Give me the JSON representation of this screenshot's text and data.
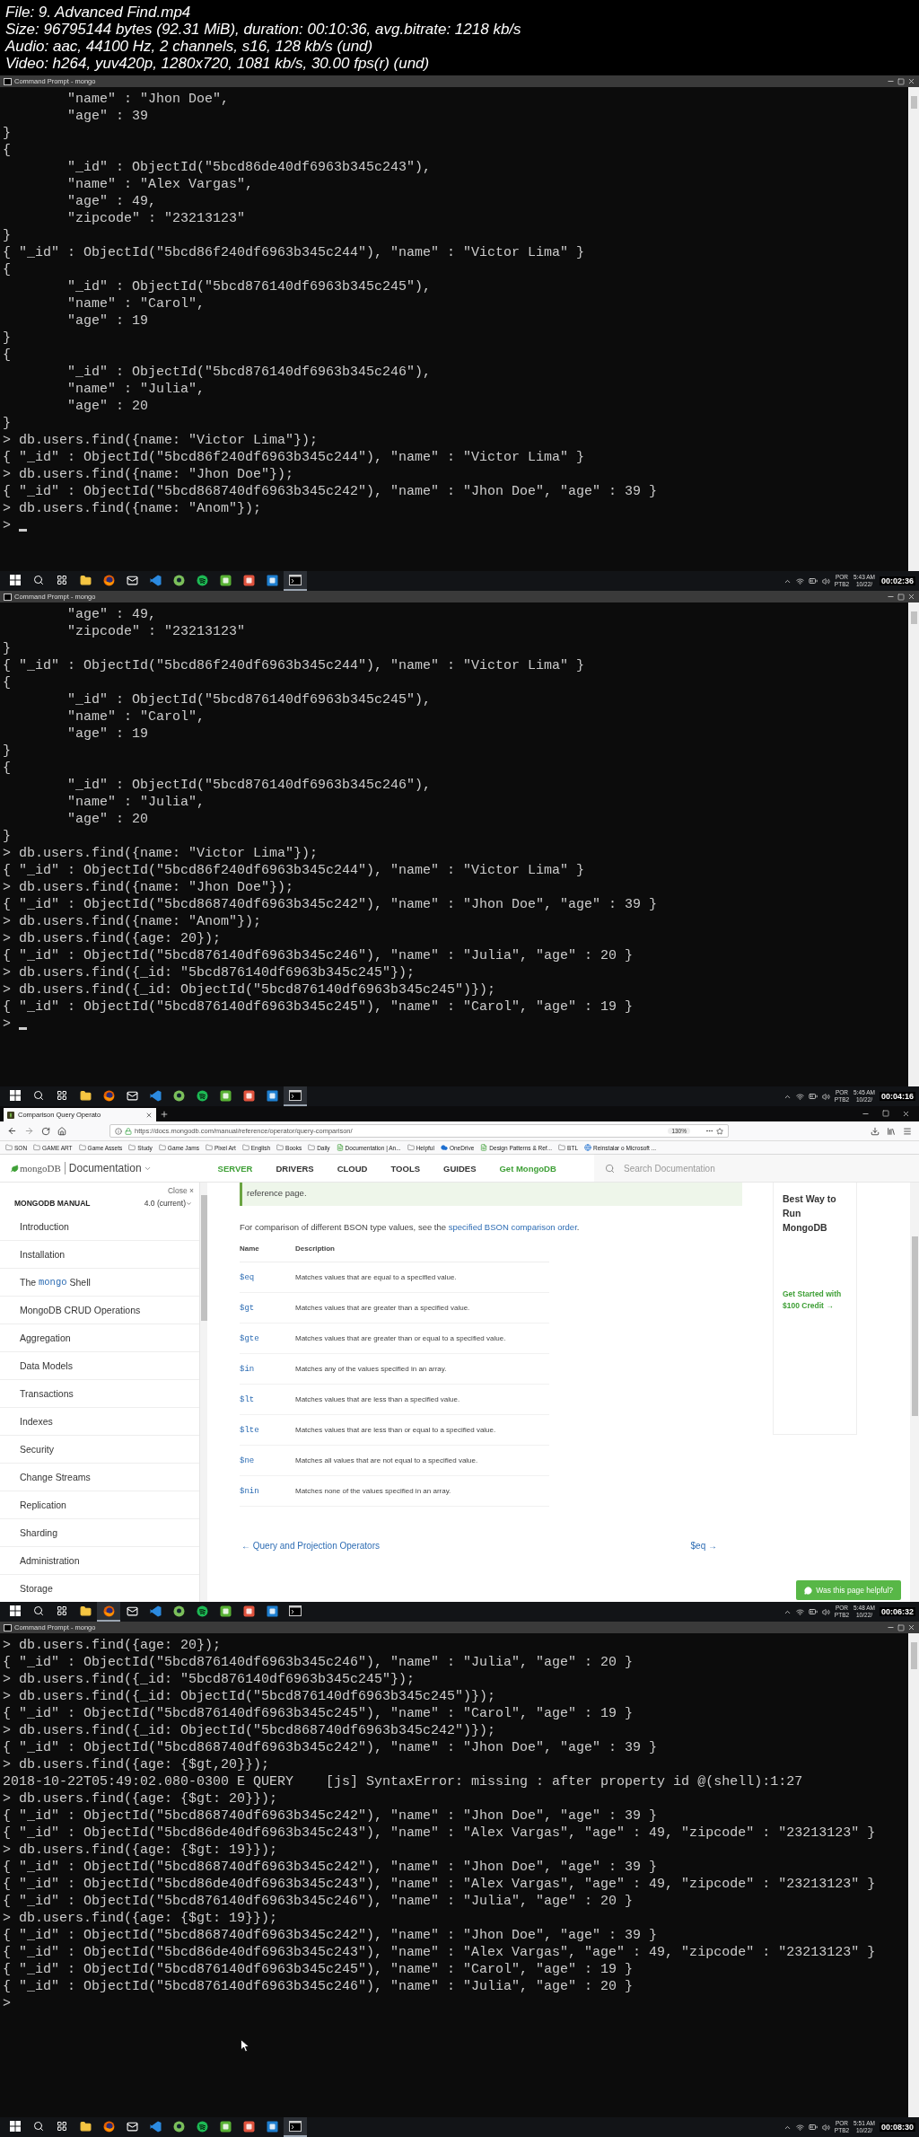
{
  "file_info": [
    "File: 9. Advanced Find.mp4",
    "Size: 96795144 bytes (92.31 MiB), duration: 00:10:36, avg.bitrate: 1218 kb/s",
    "Audio: aac, 44100 Hz, 2 channels, s16, 128 kb/s (und)",
    "Video: h264, yuv420p, 1280x720, 1081 kb/s, 30.00 fps(r) (und)"
  ],
  "frames": [
    {
      "kind": "terminal",
      "window_title": "Command Prompt - mongo",
      "cursor": true,
      "lines": [
        "        \"name\" : \"Jhon Doe\",",
        "        \"age\" : 39",
        "}",
        "{",
        "        \"_id\" : ObjectId(\"5bcd86de40df6963b345c243\"),",
        "        \"name\" : \"Alex Vargas\",",
        "        \"age\" : 49,",
        "        \"zipcode\" : \"23213123\"",
        "}",
        "{ \"_id\" : ObjectId(\"5bcd86f240df6963b345c244\"), \"name\" : \"Victor Lima\" }",
        "{",
        "        \"_id\" : ObjectId(\"5bcd876140df6963b345c245\"),",
        "        \"name\" : \"Carol\",",
        "        \"age\" : 19",
        "}",
        "{",
        "        \"_id\" : ObjectId(\"5bcd876140df6963b345c246\"),",
        "        \"name\" : \"Julia\",",
        "        \"age\" : 20",
        "}",
        "> db.users.find({name: \"Victor Lima\"});",
        "{ \"_id\" : ObjectId(\"5bcd86f240df6963b345c244\"), \"name\" : \"Victor Lima\" }",
        "> db.users.find({name: \"Jhon Doe\"});",
        "{ \"_id\" : ObjectId(\"5bcd868740df6963b345c242\"), \"name\" : \"Jhon Doe\", \"age\" : 39 }",
        "> db.users.find({name: \"Anom\"});",
        ">"
      ],
      "taskbar": {
        "language": [
          "POR",
          "PTB2"
        ],
        "time": "5:43 AM",
        "date": "10/22/",
        "timestamp": "00:02:36"
      }
    },
    {
      "kind": "terminal",
      "window_title": "Command Prompt - mongo",
      "cursor": true,
      "lines": [
        "        \"age\" : 49,",
        "        \"zipcode\" : \"23213123\"",
        "}",
        "{ \"_id\" : ObjectId(\"5bcd86f240df6963b345c244\"), \"name\" : \"Victor Lima\" }",
        "{",
        "        \"_id\" : ObjectId(\"5bcd876140df6963b345c245\"),",
        "        \"name\" : \"Carol\",",
        "        \"age\" : 19",
        "}",
        "{",
        "        \"_id\" : ObjectId(\"5bcd876140df6963b345c246\"),",
        "        \"name\" : \"Julia\",",
        "        \"age\" : 20",
        "}",
        "> db.users.find({name: \"Victor Lima\"});",
        "{ \"_id\" : ObjectId(\"5bcd86f240df6963b345c244\"), \"name\" : \"Victor Lima\" }",
        "> db.users.find({name: \"Jhon Doe\"});",
        "{ \"_id\" : ObjectId(\"5bcd868740df6963b345c242\"), \"name\" : \"Jhon Doe\", \"age\" : 39 }",
        "> db.users.find({name: \"Anom\"});",
        "> db.users.find({age: 20});",
        "{ \"_id\" : ObjectId(\"5bcd876140df6963b345c246\"), \"name\" : \"Julia\", \"age\" : 20 }",
        "> db.users.find({_id: \"5bcd876140df6963b345c245\"});",
        "> db.users.find({_id: ObjectId(\"5bcd876140df6963b345c245\")});",
        "{ \"_id\" : ObjectId(\"5bcd876140df6963b345c245\"), \"name\" : \"Carol\", \"age\" : 19 }",
        ">"
      ],
      "taskbar": {
        "language": [
          "POR",
          "PTB2"
        ],
        "time": "5:45 AM",
        "date": "10/22/",
        "timestamp": "00:04:16"
      }
    },
    {
      "kind": "browser",
      "tab_title": "Comparison Query Operato",
      "url": "https://docs.mongodb.com/manual/reference/operator/query-comparison/",
      "zoom": "130%",
      "bookmarks": [
        {
          "label": "SON",
          "kind": "folder"
        },
        {
          "label": "GAME ART",
          "kind": "folder"
        },
        {
          "label": "Game Assets",
          "kind": "folder"
        },
        {
          "label": "Study",
          "kind": "folder"
        },
        {
          "label": "Game Jams",
          "kind": "folder"
        },
        {
          "label": "Pixel Art",
          "kind": "folder"
        },
        {
          "label": "English",
          "kind": "folder"
        },
        {
          "label": "Books",
          "kind": "folder"
        },
        {
          "label": "Daily",
          "kind": "folder"
        },
        {
          "label": "Documentation | An...",
          "kind": "page"
        },
        {
          "label": "Helpful",
          "kind": "folder"
        },
        {
          "label": "OneDrive",
          "kind": "cloud"
        },
        {
          "label": "Design Patterns & Ref...",
          "kind": "page"
        },
        {
          "label": "BTL",
          "kind": "folder"
        },
        {
          "label": "Reinstalar o Microsoft ...",
          "kind": "globe"
        }
      ],
      "site": {
        "logo": "mongoDB",
        "section": "Documentation",
        "links": [
          {
            "label": "SERVER",
            "selected": true
          },
          {
            "label": "DRIVERS",
            "selected": false
          },
          {
            "label": "CLOUD",
            "selected": false
          },
          {
            "label": "TOOLS",
            "selected": false
          },
          {
            "label": "GUIDES",
            "selected": false
          }
        ],
        "cta": "Get MongoDB",
        "search_placeholder": "Search Documentation"
      },
      "sidebar": {
        "close": "Close ×",
        "title": "MONGODB MANUAL",
        "version": "4.0 (current)",
        "items": [
          {
            "label": "Introduction"
          },
          {
            "label": "Installation"
          },
          {
            "kind": "code",
            "parts": [
              "The",
              "mongo",
              "Shell"
            ]
          },
          {
            "label": "MongoDB CRUD Operations"
          },
          {
            "label": "Aggregation"
          },
          {
            "label": "Data Models"
          },
          {
            "label": "Transactions"
          },
          {
            "label": "Indexes"
          },
          {
            "label": "Security"
          },
          {
            "label": "Change Streams"
          },
          {
            "label": "Replication"
          },
          {
            "label": "Sharding"
          },
          {
            "label": "Administration"
          },
          {
            "label": "Storage"
          }
        ]
      },
      "note": "reference page.",
      "intro": {
        "text": "For comparison of different BSON type values, see the",
        "link": "specified BSON comparison order",
        "end": "."
      },
      "table": {
        "columns": [
          "Name",
          "Description"
        ],
        "rows": [
          {
            "name": "$eq",
            "description": "Matches values that are equal to a specified value."
          },
          {
            "name": "$gt",
            "description": "Matches values that are greater than a specified value."
          },
          {
            "name": "$gte",
            "description": "Matches values that are greater than or equal to a specified value."
          },
          {
            "name": "$in",
            "description": "Matches any of the values specified in an array."
          },
          {
            "name": "$lt",
            "description": "Matches values that are less than a specified value."
          },
          {
            "name": "$lte",
            "description": "Matches values that are less than or equal to a specified value."
          },
          {
            "name": "$ne",
            "description": "Matches all values that are not equal to a specified value."
          },
          {
            "name": "$nin",
            "description": "Matches none of the values specified in an array."
          }
        ]
      },
      "pager": {
        "previous": "← Query and Projection Operators",
        "next": "$eq →"
      },
      "rail": {
        "title": "Best Way to Run MongoDB",
        "link": "Get Started with $100 Credit →"
      },
      "feedback": "Was this page helpful?",
      "taskbar": {
        "language": [
          "POR",
          "PTB2"
        ],
        "time": "5:48 AM",
        "date": "10/22/",
        "timestamp": "00:06:32"
      }
    },
    {
      "kind": "terminal",
      "window_title": "Command Prompt - mongo",
      "lines": [
        "> db.users.find({age: 20});",
        "{ \"_id\" : ObjectId(\"5bcd876140df6963b345c246\"), \"name\" : \"Julia\", \"age\" : 20 }",
        "> db.users.find({_id: \"5bcd876140df6963b345c245\"});",
        "> db.users.find({_id: ObjectId(\"5bcd876140df6963b345c245\")});",
        "{ \"_id\" : ObjectId(\"5bcd876140df6963b345c245\"), \"name\" : \"Carol\", \"age\" : 19 }",
        "> db.users.find({_id: ObjectId(\"5bcd868740df6963b345c242\")});",
        "{ \"_id\" : ObjectId(\"5bcd868740df6963b345c242\"), \"name\" : \"Jhon Doe\", \"age\" : 39 }",
        "> db.users.find({age: {$gt,20}});",
        "2018-10-22T05:49:02.080-0300 E QUERY    [js] SyntaxError: missing : after property id @(shell):1:27",
        "> db.users.find({age: {$gt: 20}});",
        "{ \"_id\" : ObjectId(\"5bcd868740df6963b345c242\"), \"name\" : \"Jhon Doe\", \"age\" : 39 }",
        "{ \"_id\" : ObjectId(\"5bcd86de40df6963b345c243\"), \"name\" : \"Alex Vargas\", \"age\" : 49, \"zipcode\" : \"23213123\" }",
        "> db.users.find({age: {$gt: 19}});",
        "{ \"_id\" : ObjectId(\"5bcd868740df6963b345c242\"), \"name\" : \"Jhon Doe\", \"age\" : 39 }",
        "{ \"_id\" : ObjectId(\"5bcd86de40df6963b345c243\"), \"name\" : \"Alex Vargas\", \"age\" : 49, \"zipcode\" : \"23213123\" }",
        "{ \"_id\" : ObjectId(\"5bcd876140df6963b345c246\"), \"name\" : \"Julia\", \"age\" : 20 }",
        "> db.users.find({age: {$gt: 19}});",
        "{ \"_id\" : ObjectId(\"5bcd868740df6963b345c242\"), \"name\" : \"Jhon Doe\", \"age\" : 39 }",
        "{ \"_id\" : ObjectId(\"5bcd86de40df6963b345c243\"), \"name\" : \"Alex Vargas\", \"age\" : 49, \"zipcode\" : \"23213123\" }",
        "{ \"_id\" : ObjectId(\"5bcd876140df6963b345c245\"), \"name\" : \"Carol\", \"age\" : 19 }",
        "{ \"_id\" : ObjectId(\"5bcd876140df6963b345c246\"), \"name\" : \"Julia\", \"age\" : 20 }",
        ">"
      ],
      "taskbar": {
        "language": [
          "POR",
          "PTB2"
        ],
        "time": "5:51 AM",
        "date": "10/22/",
        "timestamp": "00:08:30"
      }
    }
  ]
}
